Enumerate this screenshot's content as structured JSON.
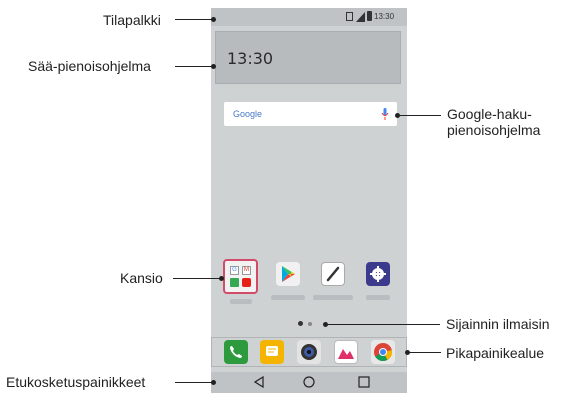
{
  "labels": {
    "status_bar": "Tilapalkki",
    "weather_widget": "Sää-pienoisohjelma",
    "google_widget_line1": "Google-haku-",
    "google_widget_line2": "pienoisohjelma",
    "folder": "Kansio",
    "page_indicator": "Sijainnin ilmaisin",
    "quick_access": "Pikapainikealue",
    "touch_buttons": "Etukosketuspainikkeet"
  },
  "phone": {
    "status_time": "13:30",
    "weather_time": "13:30",
    "search_logo": "Google"
  },
  "icons": {
    "status": [
      "nfc-icon",
      "signal-icon",
      "battery-icon"
    ],
    "home_apps": [
      "folder-icon",
      "play-store-icon",
      "pen-icon",
      "settings-icon"
    ],
    "quick_apps": [
      "phone-icon",
      "messages-icon",
      "camera-icon",
      "gallery-icon",
      "chrome-icon"
    ],
    "nav": [
      "back-icon",
      "home-icon",
      "recents-icon"
    ]
  },
  "colors": {
    "screen": "#cfd2d3",
    "bars": "#bfc3c5",
    "phone_app": "#2e9a3e",
    "messages_app": "#f4b400",
    "settings_app": "#3b3a8c"
  }
}
